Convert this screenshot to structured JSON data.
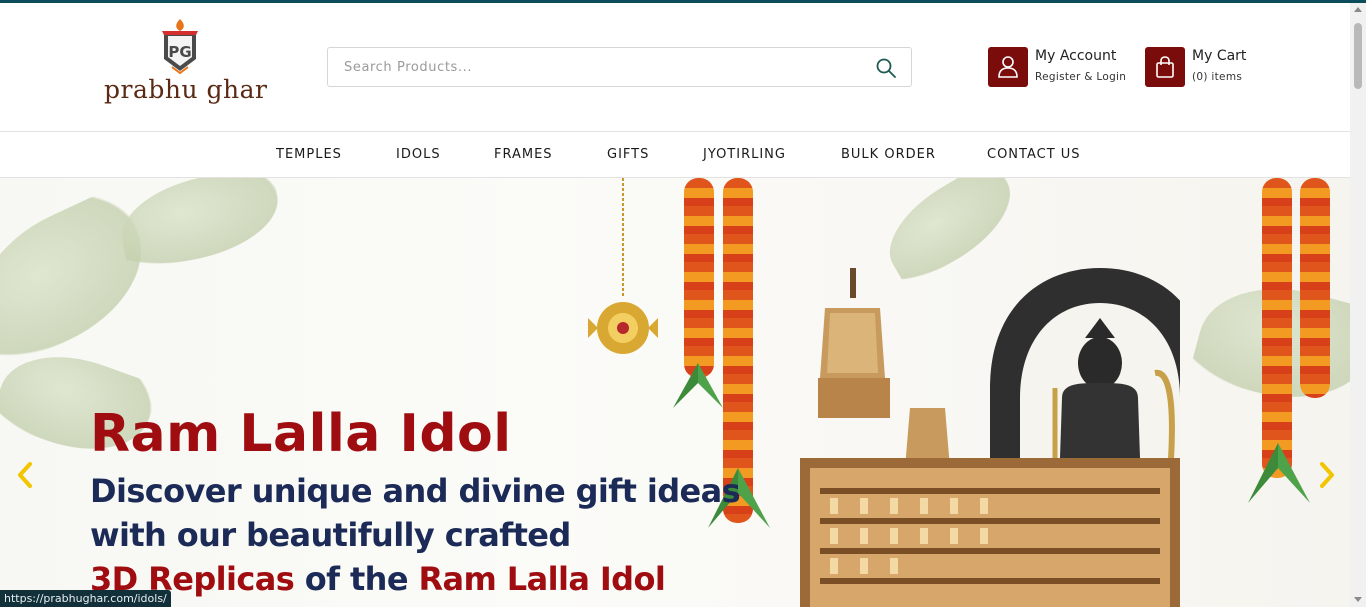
{
  "brand": {
    "name": "prabhu ghar",
    "monogram": "PG",
    "accent": "#7a0c0c"
  },
  "search": {
    "placeholder": "Search Products..."
  },
  "account": {
    "title": "My Account",
    "subtitle": "Register & Login"
  },
  "cart": {
    "title": "My Cart",
    "count": "(0)",
    "items_label": "items"
  },
  "nav": {
    "items": [
      "TEMPLES",
      "IDOLS",
      "FRAMES",
      "GIFTS",
      "JYOTIRLING",
      "BULK ORDER",
      "CONTACT US"
    ]
  },
  "hero": {
    "heading": "Ram Lalla Idol",
    "line1": "Discover unique and divine gift ideas",
    "line2": "with our beautifully crafted",
    "line3_red1": "3D Replicas",
    "line3_mid": " of the ",
    "line3_red2": "Ram Lalla Idol",
    "colors": {
      "heading": "#a00d11",
      "body": "#1b2a56"
    }
  },
  "status": {
    "url": "https://prabhughar.com/idols/"
  }
}
